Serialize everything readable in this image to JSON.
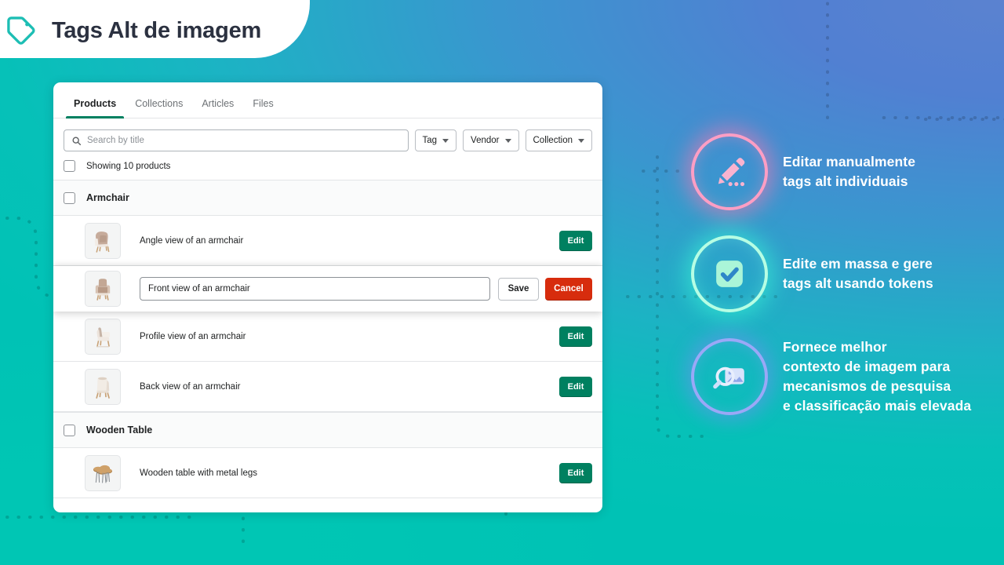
{
  "header": {
    "title": "Tags Alt de imagem",
    "icon": "tag-icon",
    "accent": "#1dbeb4"
  },
  "app": {
    "tabs": [
      {
        "label": "Products",
        "active": true
      },
      {
        "label": "Collections",
        "active": false
      },
      {
        "label": "Articles",
        "active": false
      },
      {
        "label": "Files",
        "active": false
      }
    ],
    "search": {
      "placeholder": "Search by title",
      "value": "",
      "icon": "search-icon"
    },
    "filters": [
      {
        "label": "Tag",
        "icon": "chevron-down-icon"
      },
      {
        "label": "Vendor",
        "icon": "chevron-down-icon"
      },
      {
        "label": "Collection",
        "icon": "chevron-down-icon"
      }
    ],
    "showing_label": "Showing 10 products",
    "buttons": {
      "edit": "Edit",
      "save": "Save",
      "cancel": "Cancel"
    },
    "colors": {
      "edit_green": "#008060",
      "cancel_red": "#d72c0d",
      "tab_underline": "#008060"
    },
    "groups": [
      {
        "name": "Armchair",
        "items": [
          {
            "alt": "Angle view of an armchair",
            "mode": "view",
            "thumb": "armchair-angle"
          },
          {
            "alt": "Front view of an armchair",
            "mode": "edit",
            "thumb": "armchair-front"
          },
          {
            "alt": "Profile view of an armchair",
            "mode": "view",
            "thumb": "armchair-profile"
          },
          {
            "alt": "Back view of an armchair",
            "mode": "view",
            "thumb": "armchair-back"
          }
        ]
      },
      {
        "name": "Wooden Table",
        "items": [
          {
            "alt": "Wooden table with metal legs",
            "mode": "view",
            "thumb": "wooden-table"
          }
        ]
      }
    ]
  },
  "features": [
    {
      "icon": "pencil-dots-icon",
      "glow": "pink",
      "line1": "Editar manualmente",
      "line2": "tags alt individuais",
      "line3": "",
      "line4": ""
    },
    {
      "icon": "checkbox-check-icon",
      "glow": "mint",
      "line1": "Edite em massa e gere",
      "line2": "tags alt usando tokens",
      "line3": "",
      "line4": ""
    },
    {
      "icon": "image-search-icon",
      "glow": "violet",
      "line1": "Fornece melhor",
      "line2": "contexto de imagem para",
      "line3": "mecanismos de pesquisa",
      "line4": "e classificação mais elevada"
    }
  ]
}
